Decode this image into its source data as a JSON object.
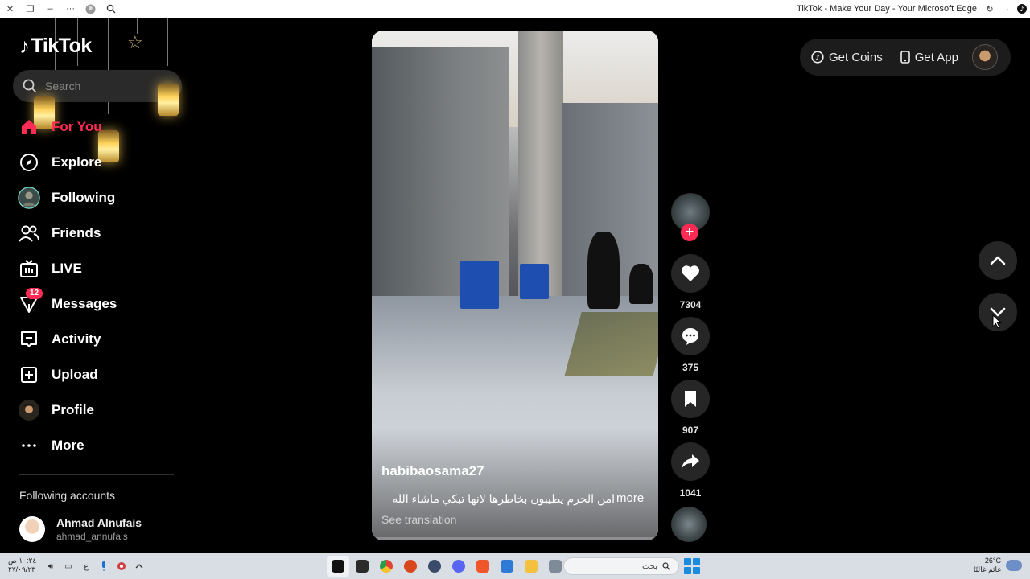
{
  "browser": {
    "title": "TikTok - Make Your Day - Your Microsoft Edge",
    "left_buttons": [
      "close-icon",
      "restore-icon",
      "minimize-icon",
      "more-icon",
      "profile-icon",
      "zoom-icon"
    ],
    "right_buttons": [
      "refresh-icon",
      "forward-icon",
      "tiktok-icon"
    ]
  },
  "sidebar": {
    "logo": "TikTok",
    "search_placeholder": "Search",
    "nav": [
      {
        "label": "For You",
        "icon": "home-icon",
        "active": true
      },
      {
        "label": "Explore",
        "icon": "compass-icon"
      },
      {
        "label": "Following",
        "icon": "following-avatar-icon"
      },
      {
        "label": "Friends",
        "icon": "friends-icon"
      },
      {
        "label": "LIVE",
        "icon": "live-icon"
      },
      {
        "label": "Messages",
        "icon": "messages-icon",
        "badge": "12"
      },
      {
        "label": "Activity",
        "icon": "activity-icon"
      },
      {
        "label": "Upload",
        "icon": "upload-icon"
      },
      {
        "label": "Profile",
        "icon": "profile-avatar-icon"
      },
      {
        "label": "More",
        "icon": "more-dots-icon"
      }
    ],
    "following_title": "Following accounts",
    "following_accounts": [
      {
        "name": "Ahmad Alnufais",
        "username": "ahmad_annufais"
      }
    ]
  },
  "video": {
    "username": "habibaosama27",
    "caption": "امن الحرم يطيبون بخاطرها لانها تبكي ماشاء الله",
    "more": "more",
    "see_translation": "See translation"
  },
  "actions": {
    "likes": "7304",
    "comments": "375",
    "saves": "907",
    "shares": "1041"
  },
  "top_right": {
    "get_coins": "Get Coins",
    "get_app": "Get App"
  },
  "taskbar": {
    "time": "١٠:٢٤ ص",
    "date": "٢٧/٠٩/٢٣",
    "lang": "ع",
    "search_placeholder": "بحث",
    "temperature": "26°C",
    "weather": "غائم غالبًا"
  },
  "colors": {
    "accent": "#fe2c55",
    "background": "#000000"
  }
}
